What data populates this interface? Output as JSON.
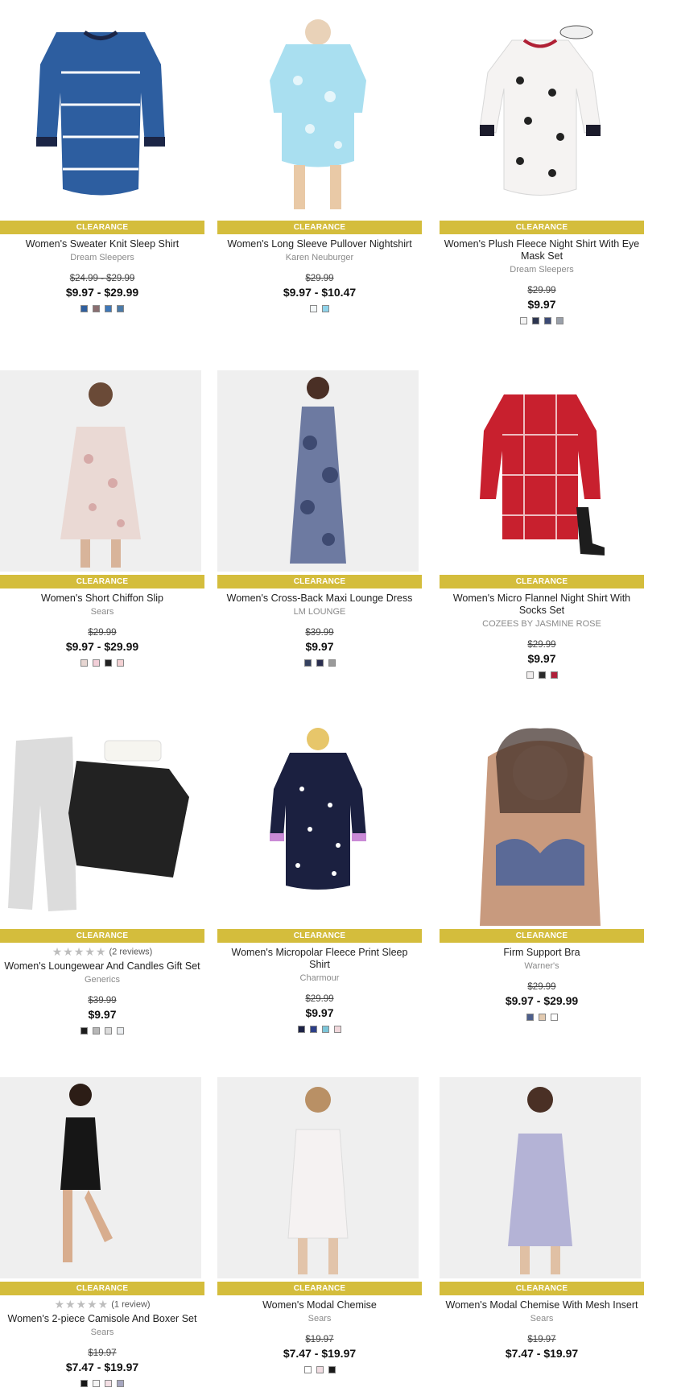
{
  "badge_label": "CLEARANCE",
  "products": [
    {
      "name": "Women's Sweater Knit Sleep Shirt",
      "brand": "Dream Sleepers",
      "was": "$24.99 - $29.99",
      "price": "$9.97 - $29.99",
      "swatches": [
        "#2f5f9e",
        "#8a6e70",
        "#3e77b8",
        "#4b7aa8"
      ],
      "rating": null,
      "reviews": ""
    },
    {
      "name": "Women's Long Sleeve Pullover Nightshirt",
      "brand": "Karen Neuburger",
      "was": "$29.99",
      "price": "$9.97 - $10.47",
      "swatches": [
        "#f3f7f8",
        "#8fd3ea"
      ],
      "rating": null,
      "reviews": ""
    },
    {
      "name": "Women's Plush Fleece Night Shirt With Eye Mask Set",
      "brand": "Dream Sleepers",
      "was": "$29.99",
      "price": "$9.97",
      "swatches": [
        "#f4f4f4",
        "#2c3550",
        "#3b4a75",
        "#9aa0aa"
      ],
      "rating": null,
      "reviews": ""
    },
    {
      "name": "Women's Short Chiffon Slip",
      "brand": "Sears",
      "was": "$29.99",
      "price": "$9.97 - $29.99",
      "swatches": [
        "#e7d6d2",
        "#f2cfd8",
        "#222222",
        "#f4d2d4"
      ],
      "rating": null,
      "reviews": ""
    },
    {
      "name": "Women's Cross-Back Maxi Lounge Dress",
      "brand": "LM LOUNGE",
      "was": "$39.99",
      "price": "$9.97",
      "swatches": [
        "#35415f",
        "#2a2e4f",
        "#9a9a9a"
      ],
      "rating": null,
      "reviews": ""
    },
    {
      "name": "Women's Micro Flannel Night Shirt With Socks Set",
      "brand": "COZEES BY JASMINE ROSE",
      "was": "$29.99",
      "price": "$9.97",
      "swatches": [
        "#f1eeee",
        "#2b2b2b",
        "#b0203a"
      ],
      "rating": null,
      "reviews": ""
    },
    {
      "name": "Women's Loungewear And Candles Gift Set",
      "brand": "Generics",
      "was": "$39.99",
      "price": "$9.97",
      "swatches": [
        "#1c1c1c",
        "#b7b7b7",
        "#dcdcdc",
        "#e9ecef"
      ],
      "rating": "★★★★★",
      "reviews": "(2 reviews)"
    },
    {
      "name": "Women's Micropolar Fleece Print Sleep Shirt",
      "brand": "Charmour",
      "was": "$29.99",
      "price": "$9.97",
      "swatches": [
        "#1d2346",
        "#2c3f88",
        "#7cc6d9",
        "#f0d7db"
      ],
      "rating": null,
      "reviews": ""
    },
    {
      "name": "Firm Support Bra",
      "brand": "Warner's",
      "was": "$29.99",
      "price": "$9.97 - $29.99",
      "swatches": [
        "#4d5f8c",
        "#e2cab0",
        "#ffffff"
      ],
      "rating": null,
      "reviews": ""
    },
    {
      "name": "Women's 2-piece Camisole And Boxer Set",
      "brand": "Sears",
      "was": "$19.97",
      "price": "$7.47 - $19.97",
      "swatches": [
        "#161616",
        "#f5f5f5",
        "#f3dfe4",
        "#a6a6bf"
      ],
      "rating": "★★★★★",
      "reviews": "(1 review)"
    },
    {
      "name": "Women's Modal Chemise",
      "brand": "Sears",
      "was": "$19.97",
      "price": "$7.47 - $19.97",
      "swatches": [
        "#ffffff",
        "#f1dde2",
        "#1a1a1a"
      ],
      "rating": null,
      "reviews": ""
    },
    {
      "name": "Women's Modal Chemise With Mesh Insert",
      "brand": "Sears",
      "was": "$19.97",
      "price": "$7.47 - $19.97",
      "swatches": [],
      "rating": null,
      "reviews": ""
    }
  ]
}
